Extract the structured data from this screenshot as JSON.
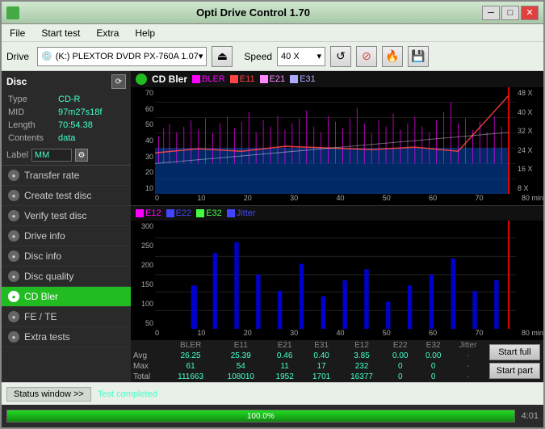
{
  "titleBar": {
    "title": "Opti Drive Control 1.70",
    "minBtn": "─",
    "maxBtn": "□",
    "closeBtn": "✕"
  },
  "menuBar": {
    "items": [
      "File",
      "Start test",
      "Extra",
      "Help"
    ]
  },
  "toolbar": {
    "driveLabel": "Drive",
    "driveIcon": "💿",
    "driveValue": "(K:)  PLEXTOR DVDR  PX-760A 1.07",
    "ejectSymbol": "⏏",
    "speedLabel": "Speed",
    "speedValue": "40 X",
    "chevron": "▾",
    "refreshSymbol": "↺",
    "eraseSymbol": "⊘",
    "burnSymbol": "🔥",
    "saveSymbol": "💾"
  },
  "disc": {
    "title": "Disc",
    "refreshBtn": "⟳",
    "type_label": "Type",
    "type_value": "CD-R",
    "mid_label": "MID",
    "mid_value": "97m27s18f",
    "length_label": "Length",
    "length_value": "70:54.38",
    "contents_label": "Contents",
    "contents_value": "data",
    "label_label": "Label",
    "label_value": "MM",
    "gearBtn": "⚙"
  },
  "navItems": [
    {
      "id": "transfer-rate",
      "label": "Transfer rate",
      "active": false
    },
    {
      "id": "create-test-disc",
      "label": "Create test disc",
      "active": false
    },
    {
      "id": "verify-test-disc",
      "label": "Verify test disc",
      "active": false
    },
    {
      "id": "drive-info",
      "label": "Drive info",
      "active": false
    },
    {
      "id": "disc-info",
      "label": "Disc info",
      "active": false
    },
    {
      "id": "disc-quality",
      "label": "Disc quality",
      "active": false
    },
    {
      "id": "cd-bler",
      "label": "CD Bler",
      "active": true
    },
    {
      "id": "fe-te",
      "label": "FE / TE",
      "active": false
    },
    {
      "id": "extra-tests",
      "label": "Extra tests",
      "active": false
    }
  ],
  "chart1": {
    "title": "CD Bler",
    "legend": [
      {
        "label": "BLER",
        "color": "#ff00ff"
      },
      {
        "label": "E11",
        "color": "#ff4444"
      },
      {
        "label": "E21",
        "color": "#ff88ff"
      },
      {
        "label": "E31",
        "color": "#aaaaff"
      }
    ],
    "yLabels": [
      "70",
      "60",
      "50",
      "40",
      "30",
      "20",
      "10"
    ],
    "yLabelsRight": [
      "48 X",
      "40 X",
      "32 X",
      "24 X",
      "16 X",
      "8 X"
    ],
    "xLabels": [
      "0",
      "10",
      "20",
      "30",
      "40",
      "50",
      "60",
      "70",
      "80 min"
    ]
  },
  "chart2": {
    "legend": [
      {
        "label": "E12",
        "color": "#ff00ff"
      },
      {
        "label": "E22",
        "color": "#4444ff"
      },
      {
        "label": "E32",
        "color": "#44ff44"
      },
      {
        "label": "Jitter",
        "color": "#4444ff"
      }
    ],
    "yLabels": [
      "300",
      "250",
      "200",
      "150",
      "100",
      "50"
    ],
    "xLabels": [
      "0",
      "10",
      "20",
      "30",
      "40",
      "50",
      "60",
      "70",
      "80 min"
    ]
  },
  "statsTable": {
    "headers": [
      "",
      "BLER",
      "E11",
      "E21",
      "E31",
      "E12",
      "E22",
      "E32",
      "Jitter",
      ""
    ],
    "rows": [
      {
        "label": "Avg",
        "values": [
          "26.25",
          "25.39",
          "0.46",
          "0.40",
          "3.85",
          "0.00",
          "0.00",
          "-"
        ]
      },
      {
        "label": "Max",
        "values": [
          "61",
          "54",
          "11",
          "17",
          "232",
          "0",
          "0",
          "-"
        ]
      },
      {
        "label": "Total",
        "values": [
          "111663",
          "108010",
          "1952",
          "1701",
          "16377",
          "0",
          "0",
          "-"
        ]
      }
    ]
  },
  "actionButtons": {
    "startFull": "Start full",
    "startPart": "Start part"
  },
  "statusBar": {
    "windowBtn": "Status window >>",
    "statusText": "Test completed"
  },
  "progressBar": {
    "percent": "100.0%",
    "fill": 100,
    "time": "4:01"
  }
}
